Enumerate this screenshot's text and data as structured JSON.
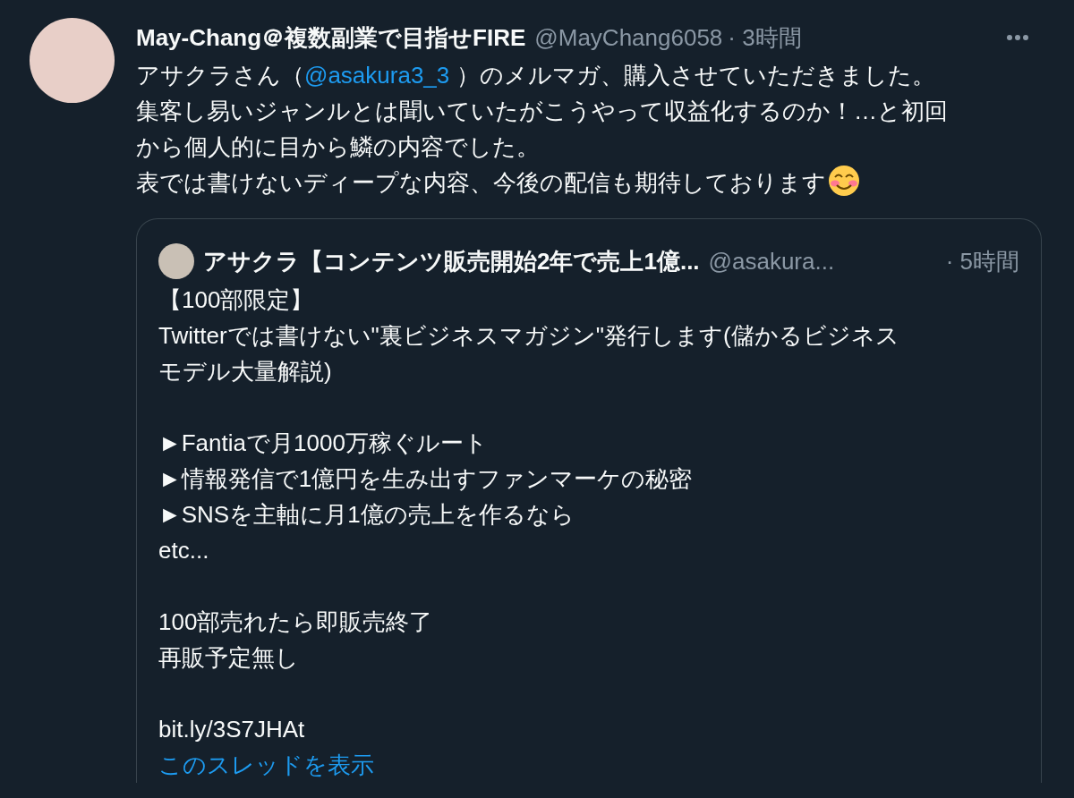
{
  "tweet": {
    "display_name": "May-Chang＠複数副業で目指せFIRE",
    "handle": "@MayChang6058",
    "time": "· 3時間",
    "body": [
      [
        {
          "kind": "text",
          "text": "アサクラさん（"
        },
        {
          "kind": "mention",
          "text": "@asakura3_3"
        },
        {
          "kind": "text",
          "text": " ）のメルマガ、購入させていただきました。"
        }
      ],
      [
        {
          "kind": "text",
          "text": "集客し易いジャンルとは聞いていたがこうやって収益化するのか！…と初回"
        }
      ],
      [
        {
          "kind": "text",
          "text": "から個人的に目から鱗の内容でした。"
        }
      ],
      [
        {
          "kind": "text",
          "text": "表では書けないディープな内容、今後の配信も期待しております"
        },
        {
          "kind": "emoji"
        }
      ]
    ],
    "quote": {
      "display_name": "アサクラ【コンテンツ販売開始2年で売上1億...",
      "handle": "@asakura...",
      "time": "· 5時間",
      "paragraphs": [
        [
          "【100部限定】",
          "Twitterでは書けない\"裏ビジネスマガジン\"発行します(儲かるビジネス",
          "モデル大量解説)"
        ],
        [
          "►Fantiaで月1000万稼ぐルート",
          "►情報発信で1億円を生み出すファンマーケの秘密",
          "►SNSを主軸に月1億の売上を作るなら",
          "etc..."
        ],
        [
          "100部売れたら即販売終了",
          "再販予定無し"
        ],
        [
          "bit.ly/3S7JHAt"
        ]
      ],
      "show_thread": "このスレッドを表示"
    }
  }
}
